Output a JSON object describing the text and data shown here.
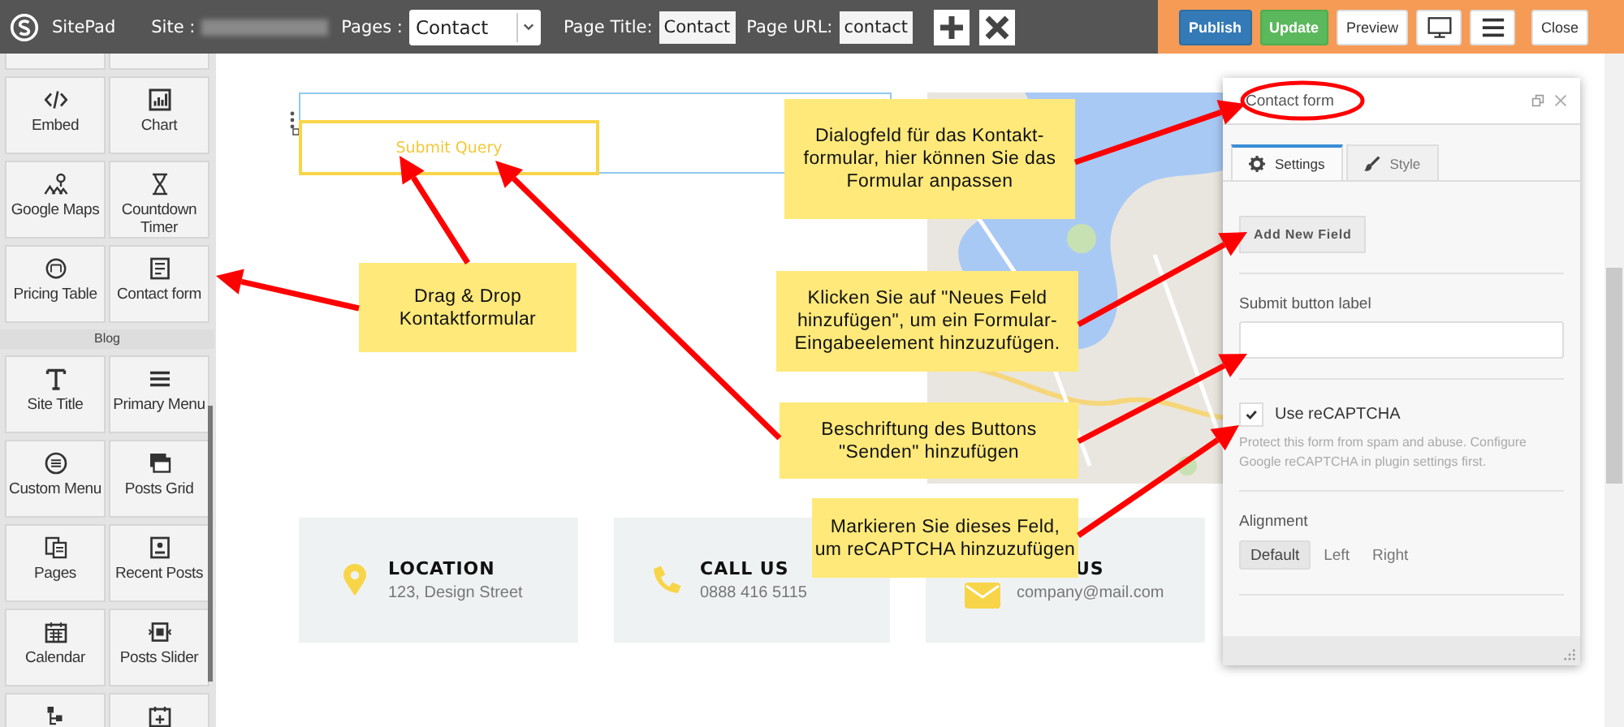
{
  "toolbar": {
    "app_name": "SitePad",
    "site_label": "Site :",
    "pages_label": "Pages :",
    "page_select": "Contact",
    "page_title_label": "Page Title:",
    "page_title_value": "Contact",
    "page_url_label": "Page URL:",
    "page_url_value": "contact",
    "actions": [
      {
        "label": "Publish",
        "kind": "primary"
      },
      {
        "label": "Update",
        "kind": "success"
      },
      {
        "label": "Preview",
        "kind": "plain"
      }
    ],
    "close_label": "Close"
  },
  "sidebar": {
    "sections": [
      {
        "tiles": [
          {
            "label": "Embed"
          },
          {
            "label": "Chart"
          },
          {
            "label": "Google Maps"
          },
          {
            "label": "Countdown Timer"
          },
          {
            "label": "Pricing Table"
          },
          {
            "label": "Contact form"
          }
        ]
      },
      {
        "title": "Blog",
        "tiles": [
          {
            "label": "Site Title"
          },
          {
            "label": "Primary Menu"
          },
          {
            "label": "Custom Menu"
          },
          {
            "label": "Posts Grid"
          },
          {
            "label": "Pages"
          },
          {
            "label": "Recent Posts"
          },
          {
            "label": "Calendar"
          },
          {
            "label": "Posts Slider"
          }
        ]
      }
    ]
  },
  "canvas": {
    "form_button": "Submit Query",
    "info_cards": [
      {
        "title": "LOCATION",
        "detail": "123, Design Street"
      },
      {
        "title": "CALL US",
        "detail": "0888 416 5115"
      },
      {
        "title": "US",
        "detail": "company@mail.com"
      }
    ]
  },
  "panel": {
    "title": "Contact form",
    "tabs": [
      {
        "label": "Settings",
        "selected": true
      },
      {
        "label": "Style",
        "selected": false
      }
    ],
    "add_button": "Add New Field",
    "submit_label_field": {
      "label": "Submit button label"
    },
    "recaptcha": {
      "label": "Use reCAPTCHA",
      "checked": true,
      "help": "Protect this form from spam and abuse. Configure Google reCAPTCHA in plugin settings first."
    },
    "alignment": {
      "label": "Alignment",
      "options": [
        {
          "label": "Default",
          "selected": true
        },
        {
          "label": "Left",
          "selected": false
        },
        {
          "label": "Right",
          "selected": false
        }
      ]
    }
  },
  "annotations": {
    "callouts": [
      {
        "text": "Dialogfeld für das Kontakt-\nformular, hier können Sie das\nFormular anpassen"
      },
      {
        "text": "Drag & Drop\nKontaktformular"
      },
      {
        "text": "Klicken Sie auf \"Neues Feld\nhinzufügen\", um ein Formular-\nEingabeelement hinzuzufügen."
      },
      {
        "text": "Beschriftung des Buttons\n\"Senden\" hinzufügen"
      },
      {
        "text": "Markieren Sie dieses Feld,\num reCAPTCHA hinzuzufügen"
      }
    ]
  }
}
